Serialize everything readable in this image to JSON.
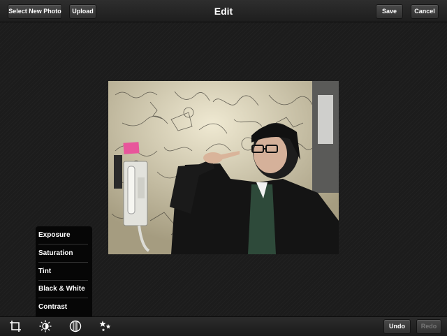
{
  "header": {
    "title": "Edit",
    "select_new_photo_label": "Select New Photo",
    "upload_label": "Upload",
    "save_label": "Save",
    "cancel_label": "Cancel"
  },
  "adjust_menu": {
    "items": [
      {
        "label": "Exposure"
      },
      {
        "label": "Saturation"
      },
      {
        "label": "Tint"
      },
      {
        "label": "Black & White"
      },
      {
        "label": "Contrast"
      }
    ]
  },
  "toolbar": {
    "tools": [
      {
        "icon": "crop-icon"
      },
      {
        "icon": "brightness-icon"
      },
      {
        "icon": "color-filter-icon"
      },
      {
        "icon": "effects-stars-icon"
      }
    ],
    "undo_label": "Undo",
    "redo_label": "Redo"
  }
}
